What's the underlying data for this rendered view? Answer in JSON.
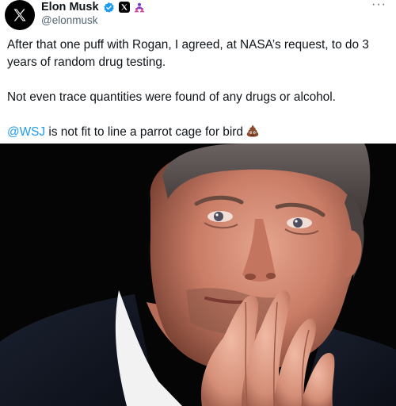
{
  "author": {
    "display_name": "Elon Musk",
    "handle": "@elonmusk"
  },
  "more_label": "···",
  "tweet": {
    "line1": "After that one puff with Rogan, I agreed, at NASA’s request, to do 3 years of random drug testing.",
    "line2": "Not even trace quantities were found of any drugs or alcohol.",
    "mention": "@WSJ",
    "line3_rest": " is not fit to line a parrot cage for bird"
  },
  "colors": {
    "link": "#1d9bf0",
    "verified": "#1d9bf0",
    "muted": "#536471"
  },
  "icons": {
    "avatar": "x-logo-icon",
    "verified": "verified-badge-icon",
    "affiliation": "x-affiliation-icon",
    "group": "people-icon",
    "emoji": "poop-emoji-icon"
  }
}
